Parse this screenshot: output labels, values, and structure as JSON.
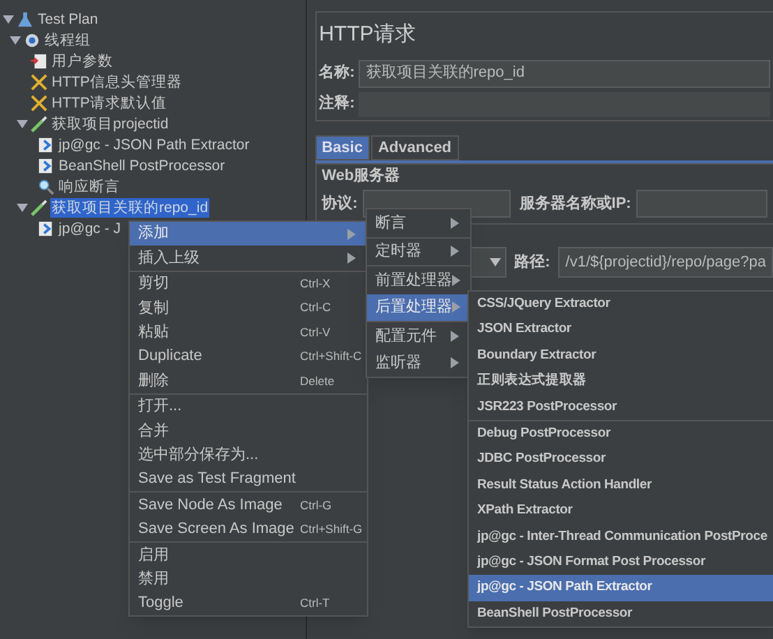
{
  "tree": [
    {
      "label": "Test Plan",
      "kind": "plan",
      "expanded": true,
      "selected": false,
      "children": [
        {
          "label": "线程组",
          "kind": "threads",
          "expanded": true,
          "selected": false,
          "children": [
            {
              "label": "用户参数",
              "kind": "params",
              "selected": false
            },
            {
              "label": "HTTP信息头管理器",
              "kind": "tool",
              "selected": false
            },
            {
              "label": "HTTP请求默认值",
              "kind": "tool",
              "selected": false
            },
            {
              "label": "获取项目projectid",
              "kind": "sampler",
              "expanded": true,
              "selected": false,
              "children": [
                {
                  "label": "jp@gc - JSON Path Extractor",
                  "kind": "post",
                  "selected": false
                },
                {
                  "label": "BeanShell PostProcessor",
                  "kind": "post",
                  "selected": false
                },
                {
                  "label": "响应断言",
                  "kind": "assert",
                  "selected": false
                }
              ]
            },
            {
              "label": "获取项目关联的repo_id",
              "kind": "sampler",
              "expanded": true,
              "selected": true,
              "children": [
                {
                  "label": "jp@gc - J",
                  "kind": "post",
                  "selected": false
                }
              ]
            }
          ]
        }
      ]
    }
  ],
  "panel": {
    "title": "HTTP请求",
    "name_label": "名称:",
    "name_value": "获取项目关联的repo_id",
    "comment_label": "注释:",
    "tabs": [
      {
        "label": "Basic",
        "selected": true
      },
      {
        "label": "Advanced",
        "selected": false
      }
    ],
    "group_title": "Web服务器",
    "protocol_label": "协议:",
    "server_label": "服务器名称或IP:",
    "path_label": "路径:",
    "path_value": "/v1/${projectid}/repo/page?pa"
  },
  "context_menu": [
    [
      {
        "label": "添加",
        "submenu": true,
        "selected": true
      },
      {
        "label": "插入上级",
        "submenu": true,
        "selected": false
      }
    ],
    [
      {
        "label": "剪切",
        "shortcut": "Ctrl-X",
        "selected": false
      },
      {
        "label": "复制",
        "shortcut": "Ctrl-C",
        "selected": false
      },
      {
        "label": "粘贴",
        "shortcut": "Ctrl-V",
        "selected": false
      },
      {
        "label": "Duplicate",
        "shortcut": "Ctrl+Shift-C",
        "selected": false
      },
      {
        "label": "删除",
        "shortcut": "Delete",
        "selected": false
      }
    ],
    [
      {
        "label": "打开...",
        "selected": false
      },
      {
        "label": "合并",
        "selected": false
      },
      {
        "label": "选中部分保存为...",
        "selected": false
      },
      {
        "label": "Save as Test Fragment",
        "selected": false
      }
    ],
    [
      {
        "label": "Save Node As Image",
        "shortcut": "Ctrl-G",
        "selected": false
      },
      {
        "label": "Save Screen As Image",
        "shortcut": "Ctrl+Shift-G",
        "selected": false
      }
    ],
    [
      {
        "label": "启用",
        "selected": false
      },
      {
        "label": "禁用",
        "selected": false
      },
      {
        "label": "Toggle",
        "shortcut": "Ctrl-T",
        "selected": false
      }
    ]
  ],
  "add_menu": [
    [
      {
        "label": "断言",
        "submenu": true,
        "selected": false
      }
    ],
    [
      {
        "label": "定时器",
        "submenu": true,
        "selected": false
      }
    ],
    [
      {
        "label": "前置处理器",
        "submenu": true,
        "selected": false
      },
      {
        "label": "后置处理器",
        "submenu": true,
        "selected": true
      }
    ],
    [
      {
        "label": "配置元件",
        "submenu": true,
        "selected": false
      },
      {
        "label": "监听器",
        "submenu": true,
        "selected": false
      }
    ]
  ],
  "post_menu": [
    [
      {
        "label": "CSS/JQuery Extractor",
        "selected": false
      },
      {
        "label": "JSON Extractor",
        "selected": false
      },
      {
        "label": "Boundary Extractor",
        "selected": false
      },
      {
        "label": "正则表达式提取器",
        "selected": false
      },
      {
        "label": "JSR223 PostProcessor",
        "selected": false
      }
    ],
    [
      {
        "label": "Debug PostProcessor",
        "selected": false
      },
      {
        "label": "JDBC PostProcessor",
        "selected": false
      },
      {
        "label": "Result Status Action Handler",
        "selected": false
      },
      {
        "label": "XPath Extractor",
        "selected": false
      },
      {
        "label": "jp@gc - Inter-Thread Communication PostProce",
        "selected": false
      },
      {
        "label": "jp@gc - JSON Format Post Processor",
        "selected": false
      },
      {
        "label": "jp@gc - JSON Path Extractor",
        "selected": true
      },
      {
        "label": "BeanShell PostProcessor",
        "selected": false
      }
    ]
  ]
}
